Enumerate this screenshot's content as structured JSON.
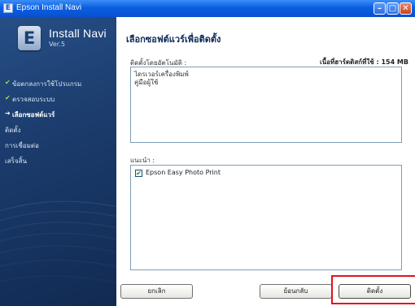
{
  "window": {
    "title": "Epson Install Navi",
    "app_icon_letter": "E",
    "controls": {
      "minimize": "–",
      "maximize": "□",
      "close": "✕"
    }
  },
  "sidebar": {
    "brand_title": "Install Navi",
    "brand_version": "Ver.5",
    "logo_letter": "E",
    "steps": [
      {
        "label": "ข้อตกลงการใช้โปรแกรม",
        "state": "done",
        "mark": "✔"
      },
      {
        "label": "ตรวจสอบระบบ",
        "state": "done",
        "mark": "✔"
      },
      {
        "label": "เลือกซอฟต์แวร์",
        "state": "current",
        "mark": "➔"
      },
      {
        "label": "ติดตั้ง",
        "state": "pending",
        "mark": ""
      },
      {
        "label": "การเชื่อมต่อ",
        "state": "pending",
        "mark": ""
      },
      {
        "label": "เสร็จสิ้น",
        "state": "pending",
        "mark": ""
      }
    ]
  },
  "main": {
    "title": "เลือกซอฟต์แวร์เพื่อติดตั้ง",
    "auto_install_label": "ติดตั้งโดยอัตโนมัติ :",
    "disk_space_label": "เนื้อที่ฮาร์ดดิสก์ที่ใช้ : 154 MB",
    "auto_install_items": [
      "ไดรเวอร์เครื่องพิมพ์",
      "คู่มือผู้ใช้"
    ],
    "recommended_label": "แนะนำ :",
    "recommended_items": [
      {
        "label": "Epson Easy Photo Print",
        "checked": true,
        "check_glyph": "✔"
      }
    ]
  },
  "buttons": {
    "cancel": "ยกเลิก",
    "back": "ย้อนกลับ",
    "install": "ติดตั้ง"
  },
  "colors": {
    "titlebar": "#0a5fe0",
    "sidebar": "#1b3c6d",
    "highlight_box": "#e3121b",
    "check_done": "#9be05a"
  }
}
